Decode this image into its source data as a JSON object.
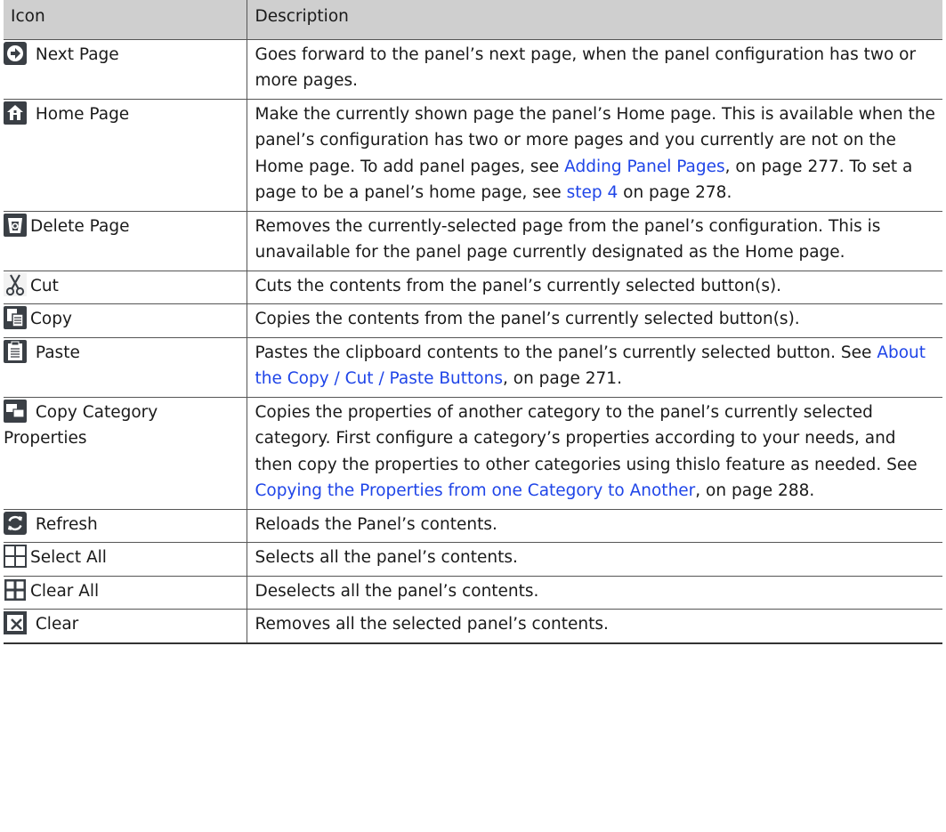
{
  "table": {
    "header": {
      "icon": "Icon",
      "description": "Description"
    },
    "rows": [
      {
        "icon": "next-page-icon",
        "label": "Next Page",
        "gap": true,
        "desc": [
          {
            "t": "Goes forward to the panel’s next page, when the panel configuration has two or more pages."
          }
        ]
      },
      {
        "icon": "home-page-icon",
        "label": "Home Page",
        "gap": true,
        "desc": [
          {
            "t": "Make the currently shown page the panel’s Home page. This is available when the panel’s configuration has two or more pages and you currently are not on the Home page. To add panel pages, see "
          },
          {
            "t": "Adding Panel Pages",
            "link": true
          },
          {
            "t": ", on page 277. To set a page to be a panel’s home page, see "
          },
          {
            "t": "step 4",
            "link": true
          },
          {
            "t": " on page 278."
          }
        ]
      },
      {
        "icon": "delete-page-icon",
        "label": "Delete Page",
        "gap": false,
        "desc": [
          {
            "t": "Removes the currently-selected page from the panel’s configuration. This is unavailable for the panel page currently designated as the Home page."
          }
        ]
      },
      {
        "icon": "cut-icon",
        "label": "Cut",
        "gap": false,
        "desc": [
          {
            "t": "Cuts the contents from the panel’s currently selected button(s)."
          }
        ]
      },
      {
        "icon": "copy-icon",
        "label": "Copy",
        "gap": false,
        "desc": [
          {
            "t": "Copies the contents from the panel’s currently selected button(s)."
          }
        ]
      },
      {
        "icon": "paste-icon",
        "label": "Paste",
        "gap": true,
        "desc": [
          {
            "t": "Pastes the clipboard contents to the panel’s currently selected button. See "
          },
          {
            "t": "About the Copy / Cut / Paste Buttons",
            "link": true
          },
          {
            "t": ", on page 271."
          }
        ]
      },
      {
        "icon": "copy-category-properties-icon",
        "label": "Copy Category Properties",
        "gap": true,
        "desc": [
          {
            "t": "Copies the properties of another category to the panel’s currently selected category. First configure a category’s properties according to your needs, and then copy the properties to other categories using thislo feature as needed. See "
          },
          {
            "t": "Copying the Properties from one Category to Another",
            "link": true
          },
          {
            "t": ", on page 288."
          }
        ]
      },
      {
        "icon": "refresh-icon",
        "label": "Refresh",
        "gap": true,
        "desc": [
          {
            "t": "Reloads the Panel’s contents."
          }
        ]
      },
      {
        "icon": "select-all-icon",
        "label": "Select All",
        "gap": false,
        "desc": [
          {
            "t": "Selects all the panel’s contents."
          }
        ]
      },
      {
        "icon": "clear-all-icon",
        "label": "Clear All",
        "gap": false,
        "desc": [
          {
            "t": "Deselects all the panel’s contents."
          }
        ]
      },
      {
        "icon": "clear-icon",
        "label": "Clear",
        "gap": true,
        "desc": [
          {
            "t": "Removes all the selected panel’s contents."
          }
        ]
      }
    ]
  }
}
